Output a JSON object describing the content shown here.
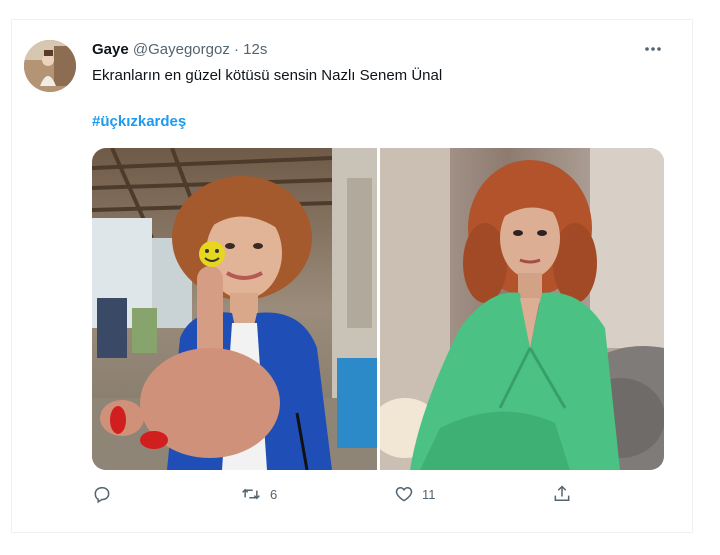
{
  "tweet": {
    "display_name": "Gaye",
    "handle": "@Gayegorgoz",
    "separator": "·",
    "time": "12s",
    "text": "Ekranların en güzel kötüsü sensin Nazlı Senem Ünal",
    "hashtag": "#üçkızkardeş"
  },
  "actions": {
    "reply_count": "",
    "retweet_count": "6",
    "like_count": "11"
  },
  "colors": {
    "link": "#1d9bf0",
    "muted": "#536471",
    "text": "#0f1419"
  },
  "icons": {
    "more": "more-icon",
    "reply": "reply-icon",
    "retweet": "retweet-icon",
    "like": "heart-icon",
    "share": "share-icon"
  }
}
